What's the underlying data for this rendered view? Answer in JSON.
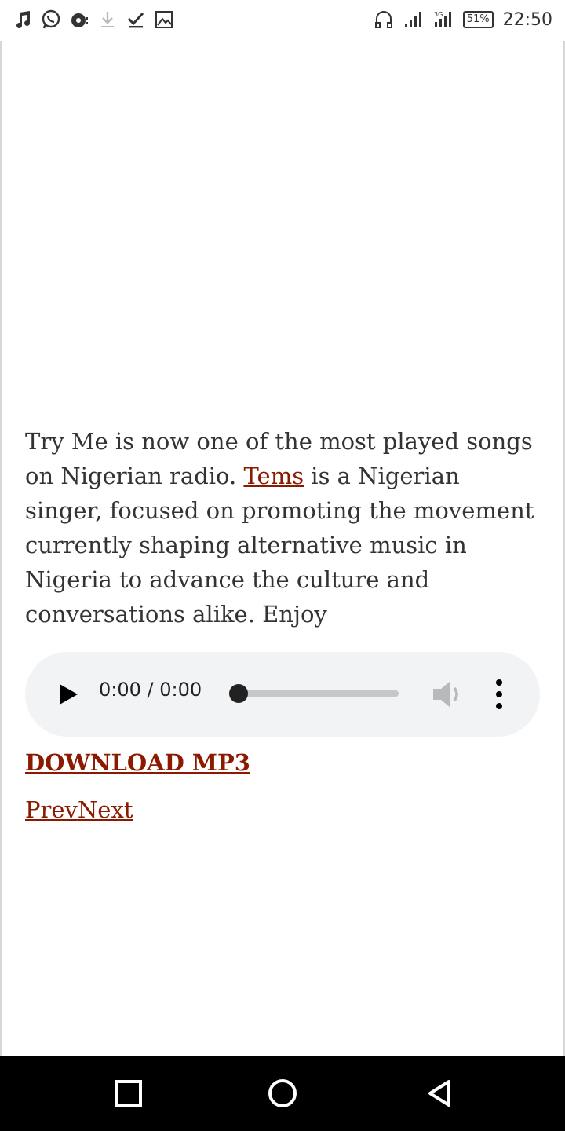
{
  "status_bar": {
    "battery": "51%",
    "time": "22:50",
    "icons_left": [
      "music-icon",
      "whatsapp-icon",
      "media-icon",
      "download-icon",
      "check-icon",
      "image-icon"
    ],
    "icons_right": [
      "headset-icon",
      "signal-icon",
      "signal-3g-icon",
      "battery-icon"
    ]
  },
  "article": {
    "text_before_link": "Try Me is now one of the most played songs on Nigerian radio. ",
    "link_text": "Tems",
    "text_after_link": " is a Nigerian singer, focused on promoting the movement currently shaping alternative music in Nigeria to advance the culture and conversations alike. Enjoy"
  },
  "audio_player": {
    "time_display": "0:00 / 0:00",
    "progress_fraction": 0
  },
  "download": {
    "label": "DOWNLOAD MP3"
  },
  "post_nav": {
    "prev": "Prev",
    "next": "Next"
  },
  "colors": {
    "link": "#8b1a00",
    "text": "#333333",
    "player_bg": "#f1f3f4"
  }
}
